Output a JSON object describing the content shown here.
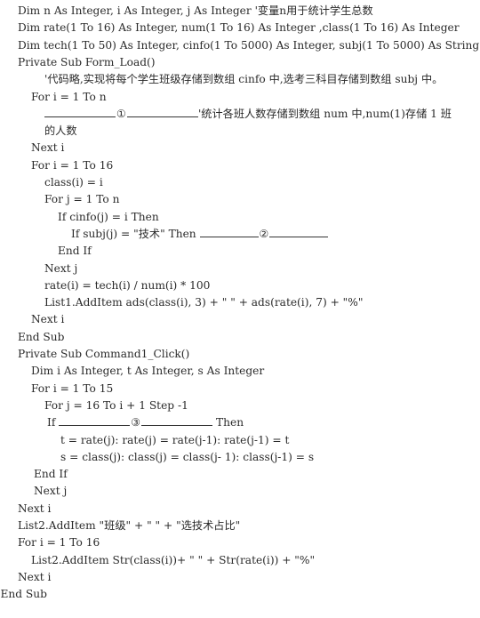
{
  "lines": [
    {
      "indent": 0,
      "text": "Dim n As Integer, i As Integer, j As Integer '变量n用于统计学生总数"
    },
    {
      "indent": 0,
      "text": "Dim rate(1 To 16) As Integer, num(1 To 16) As Integer ,class(1 To 16) As Integer"
    },
    {
      "indent": 0,
      "text": "Dim tech(1 To 50) As Integer, cinfo(1 To 5000) As Integer, subj(1 To 5000) As String"
    },
    {
      "indent": 0,
      "text": "Private Sub Form_Load()"
    },
    {
      "indent": 2,
      "text": "'代码略,实现将每个学生班级存储到数组 cinfo 中,选考三科目存储到数组 subj 中。"
    },
    {
      "indent": 1,
      "text": "For i = 1 To n"
    },
    {
      "indent": 2,
      "blank": {
        "before": "",
        "mark": "①",
        "after": "'统计各班人数存储到数组 num 中,num(1)存储 1 班"
      }
    },
    {
      "indent": 2,
      "text": "的人数"
    },
    {
      "indent": 1,
      "text": "Next i"
    },
    {
      "indent": 1,
      "text": "For i = 1 To 16"
    },
    {
      "indent": 2,
      "text": "class(i) = i"
    },
    {
      "indent": 2,
      "text": "For j = 1 To n"
    },
    {
      "indent": 3,
      "text": "If cinfo(j) = i Then"
    },
    {
      "indent": 4,
      "blank": {
        "before": "If subj(j) = \"技术\" Then ",
        "mark": "②",
        "after": ""
      }
    },
    {
      "indent": 3,
      "text": "End If"
    },
    {
      "indent": 2,
      "text": "Next j"
    },
    {
      "indent": 2,
      "text": "rate(i) = tech(i) / num(i) * 100"
    },
    {
      "indent": 2,
      "text": "List1.AddItem ads(class(i), 3) + \" \" + ads(rate(i), 7) + \"%\""
    },
    {
      "indent": 1,
      "text": "Next i"
    },
    {
      "indent": 0,
      "text": "End Sub"
    },
    {
      "indent": 0,
      "text": "Private Sub Command1_Click()"
    },
    {
      "indent": 1,
      "text": "Dim i As Integer, t As Integer, s As Integer"
    },
    {
      "indent": 1,
      "text": "For i = 1 To 15"
    },
    {
      "indent": 2,
      "text": "For j = 16 To i + 1 Step -1"
    },
    {
      "indent": 2.2,
      "blank": {
        "before": "If ",
        "mark": "③",
        "after": " Then"
      }
    },
    {
      "indent": 3.2,
      "text": "t = rate(j): rate(j) = rate(j-1): rate(j-1) = t"
    },
    {
      "indent": 3.2,
      "text": "s = class(j): class(j) = class(j- 1): class(j-1) = s"
    },
    {
      "indent": 1.2,
      "text": "End If"
    },
    {
      "indent": 1.2,
      "text": "Next j"
    },
    {
      "indent": 0,
      "text": "Next i"
    },
    {
      "indent": 0,
      "text": "List2.AddItem \"班级\" + \" \" + \"选技术占比\""
    },
    {
      "indent": 0,
      "text": "For i = 1 To 16"
    },
    {
      "indent": 1,
      "text": "List2.AddItem Str(class(i))+ \" \" + Str(rate(i)) + \"%\""
    },
    {
      "indent": 0,
      "text": "Next i"
    },
    {
      "indent": -1.3,
      "text": "End Sub"
    }
  ]
}
